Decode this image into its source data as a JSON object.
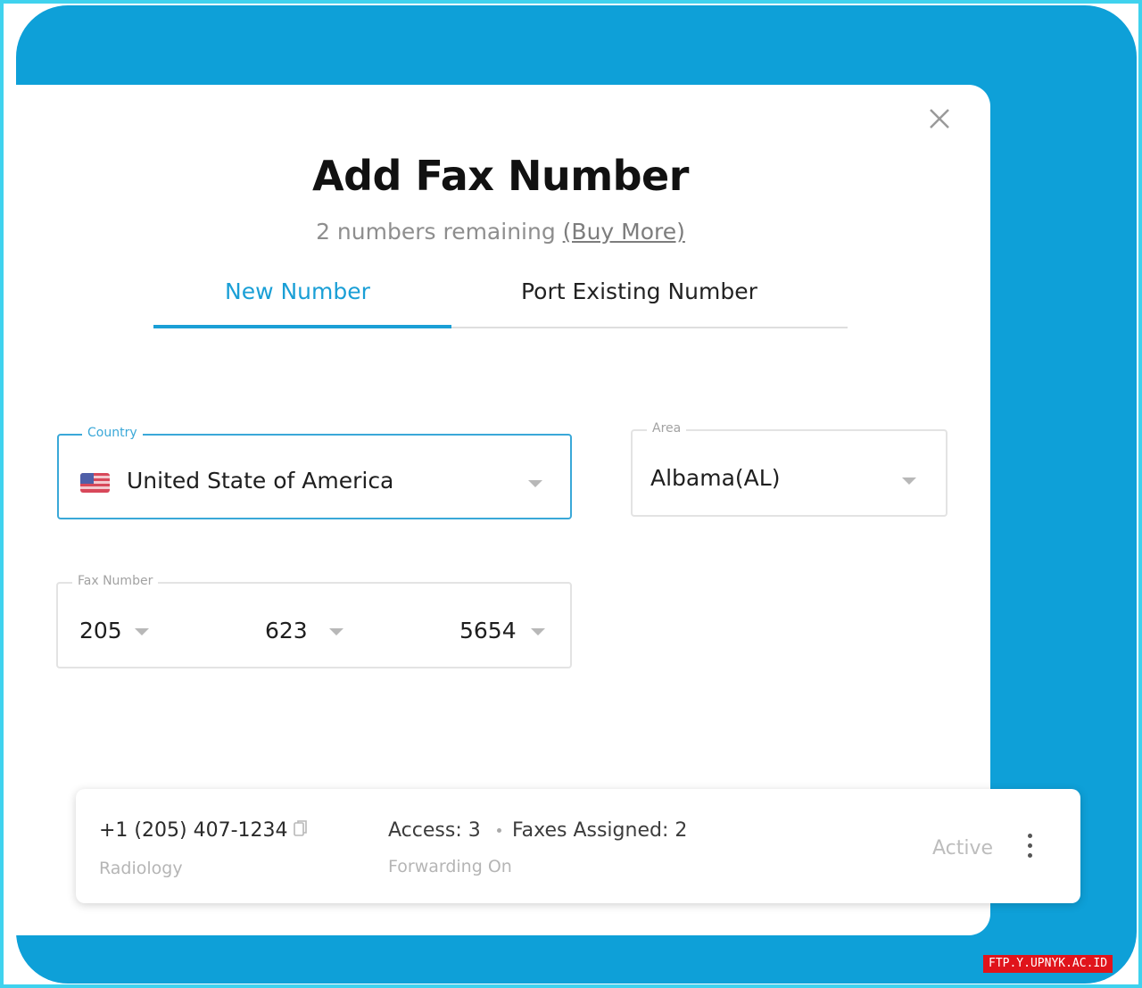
{
  "modal": {
    "title": "Add Fax Number",
    "remaining_text": "2 numbers remaining",
    "buy_more_link": "(Buy More)",
    "close_icon": "close-icon"
  },
  "tabs": [
    {
      "label": "New Number",
      "active": true
    },
    {
      "label": "Port Existing Number",
      "active": false
    }
  ],
  "form": {
    "country": {
      "label": "Country",
      "value": "United State of America",
      "flag_icon": "us-flag-icon"
    },
    "area": {
      "label": "Area",
      "value": "Albama(AL)"
    },
    "fax_number": {
      "label": "Fax Number",
      "parts": [
        "205",
        "623",
        "5654"
      ]
    }
  },
  "number_card": {
    "phone": "+1 (205) 407-1234",
    "department": "Radiology",
    "access": "Access: 3",
    "faxes_assigned": "Faxes Assigned: 2",
    "forwarding": "Forwarding On",
    "status": "Active",
    "copy_icon": "copy-icon",
    "menu_icon": "kebab-menu-icon"
  },
  "watermark": "FTP.Y.UPNYK.AC.ID",
  "colors": {
    "accent": "#1a9fd6",
    "panel_blue": "#0ea0d8",
    "frame_border": "#3fd2ee",
    "watermark_bg": "#e0141b"
  }
}
